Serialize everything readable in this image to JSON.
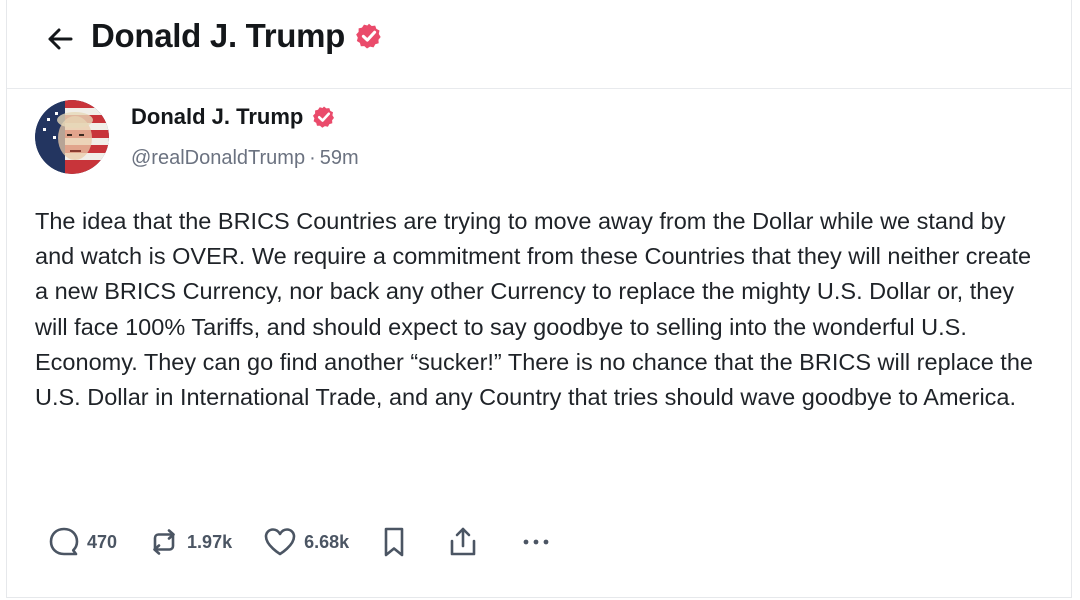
{
  "header": {
    "title": "Donald J. Trump"
  },
  "post": {
    "author_name": "Donald J. Trump",
    "handle": "@realDonaldTrump",
    "separator": "·",
    "time_ago": "59m",
    "text": "The idea that the BRICS Countries are trying to move away from the Dollar while we stand by and watch is OVER. We require a commitment from these Countries that they will neither create a new BRICS Currency, nor back any other Currency to replace the mighty U.S. Dollar or, they will face 100% Tariffs, and should expect to say goodbye to selling into the wonderful U.S. Economy. They can go find another “sucker!” There is no chance that the BRICS will replace the U.S. Dollar in International Trade, and any Country that tries should wave goodbye to America."
  },
  "actions": {
    "replies": "470",
    "reposts": "1.97k",
    "likes": "6.68k"
  },
  "colors": {
    "verified_badge": "#ea4b6b",
    "text_primary": "#14171a",
    "text_secondary": "#6b7280",
    "divider": "#e8eaed"
  },
  "icons": [
    "back-arrow-icon",
    "verified-badge-icon",
    "reply-icon",
    "repost-icon",
    "like-icon",
    "bookmark-icon",
    "share-icon",
    "more-icon"
  ]
}
